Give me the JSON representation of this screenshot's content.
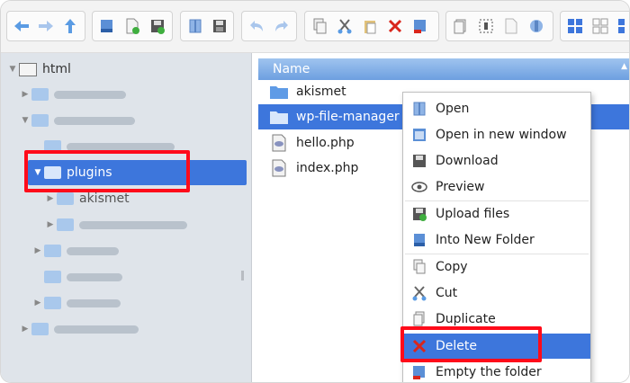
{
  "toolbar": {
    "icons": [
      "back-icon",
      "forward-icon",
      "up-icon",
      "download-icon",
      "new-file-icon",
      "save-icon",
      "open-icon",
      "save-disk-icon",
      "undo-icon",
      "redo-icon",
      "copy-icon",
      "cut-icon",
      "paste-icon",
      "delete-icon",
      "empty-icon",
      "duplicate-icon",
      "select-all-icon",
      "rename-icon",
      "network-icon",
      "icons-view-icon",
      "list-view-icon",
      "more-icon"
    ]
  },
  "sidebar": {
    "root_label": "html",
    "selected_label": "plugins",
    "child_label": "akismet"
  },
  "pane": {
    "header_name": "Name",
    "files": [
      {
        "name": "akismet",
        "type": "folder"
      },
      {
        "name": "wp-file-manager",
        "type": "folder"
      },
      {
        "name": "hello.php",
        "type": "php"
      },
      {
        "name": "index.php",
        "type": "php"
      }
    ]
  },
  "menu": {
    "items": [
      {
        "label": "Open",
        "icon": "open-icon"
      },
      {
        "label": "Open in new window",
        "icon": "new-window-icon"
      },
      {
        "label": "Download",
        "icon": "download-icon"
      },
      {
        "label": "Preview",
        "icon": "eye-icon"
      },
      {
        "label": "Upload files",
        "icon": "upload-icon"
      },
      {
        "label": "Into New Folder",
        "icon": "new-folder-icon"
      },
      {
        "label": "Copy",
        "icon": "copy-icon"
      },
      {
        "label": "Cut",
        "icon": "cut-icon"
      },
      {
        "label": "Duplicate",
        "icon": "duplicate-icon"
      },
      {
        "label": "Delete",
        "icon": "delete-icon"
      },
      {
        "label": "Empty the folder",
        "icon": "empty-folder-icon"
      }
    ]
  },
  "colors": {
    "selection": "#3d76dc",
    "highlight_box": "#ff0b1a",
    "sidebar_bg": "#dfe4ea"
  }
}
